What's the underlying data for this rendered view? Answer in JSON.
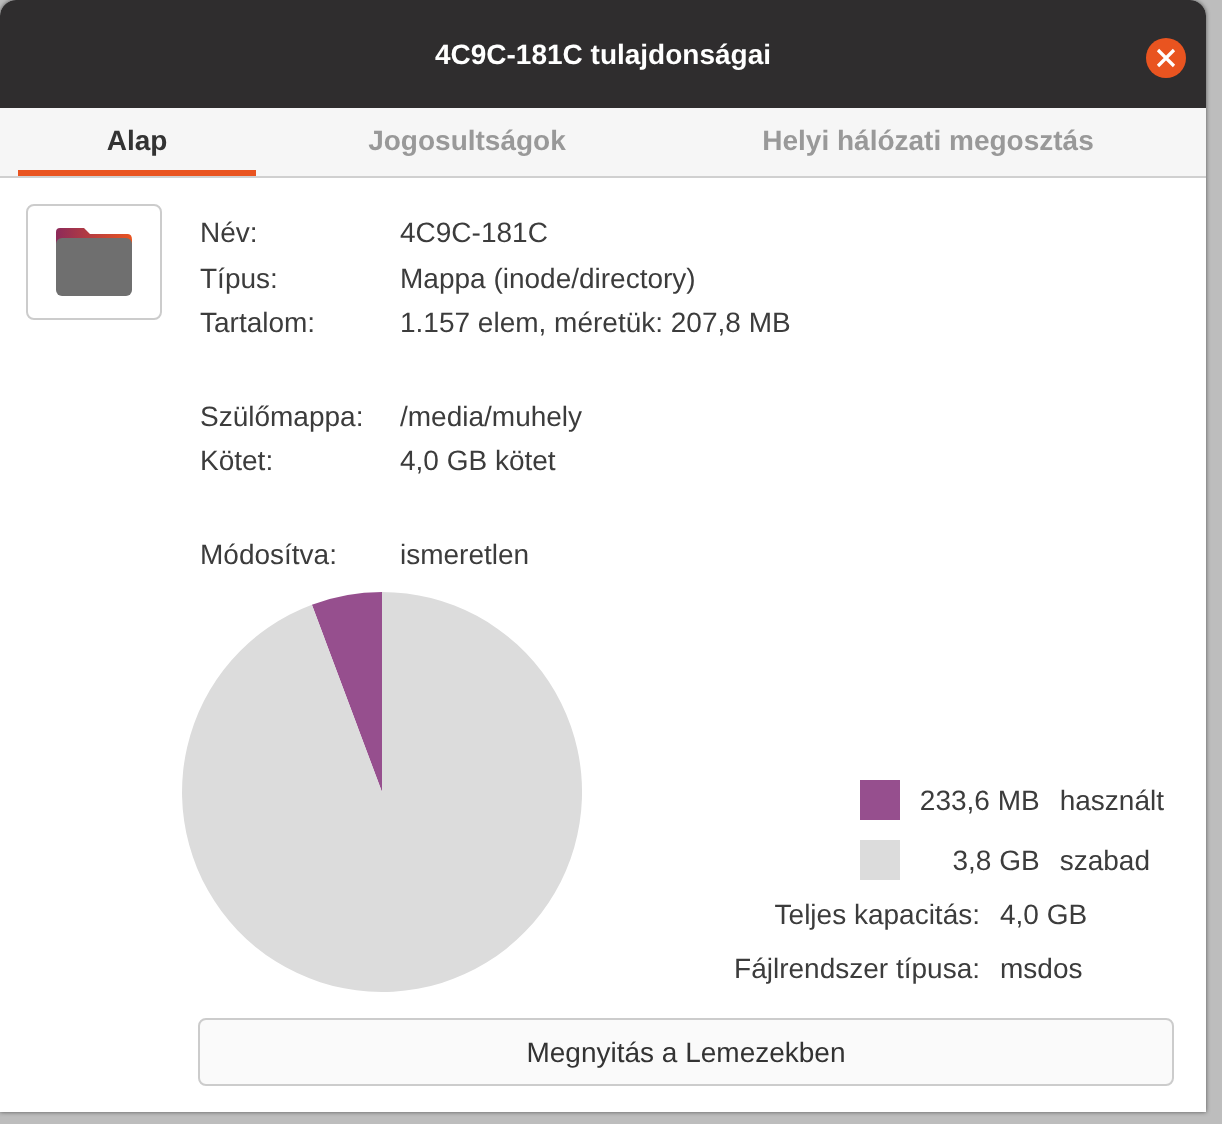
{
  "window": {
    "title": "4C9C-181C tulajdonságai"
  },
  "tabs": [
    {
      "label": "Alap",
      "selected": true
    },
    {
      "label": "Jogosultságok",
      "selected": false
    },
    {
      "label": "Helyi hálózati megosztás",
      "selected": false
    }
  ],
  "info": [
    {
      "label": "Név:",
      "value": "4C9C-181C"
    },
    {
      "label": "Típus:",
      "value": "Mappa (inode/directory)"
    },
    {
      "label": "Tartalom:",
      "value": "1.157 elem, méretük: 207,8 MB"
    },
    {
      "kind": "gap"
    },
    {
      "label": "Szülőmappa:",
      "value": "/media/muhely"
    },
    {
      "label": "Kötet:",
      "value": "4,0 GB kötet"
    },
    {
      "kind": "gap"
    },
    {
      "label": "Módosítva:",
      "value": "ismeretlen"
    }
  ],
  "usage": {
    "chart_data": {
      "type": "pie",
      "values": [
        5.7,
        94.3
      ]
    }
  },
  "legend": [
    {
      "amount": "233,6 MB",
      "label": "használt",
      "color": "#964f8e"
    },
    {
      "amount": "3,8 GB",
      "label": "szabad",
      "color": "#dcdcdc"
    }
  ],
  "details": [
    {
      "label": "Teljes kapacitás:",
      "value": "4,0 GB"
    },
    {
      "label": "Fájlrendszer típusa:",
      "value": "msdos"
    }
  ],
  "button": "Megnyitás a Lemezekben"
}
